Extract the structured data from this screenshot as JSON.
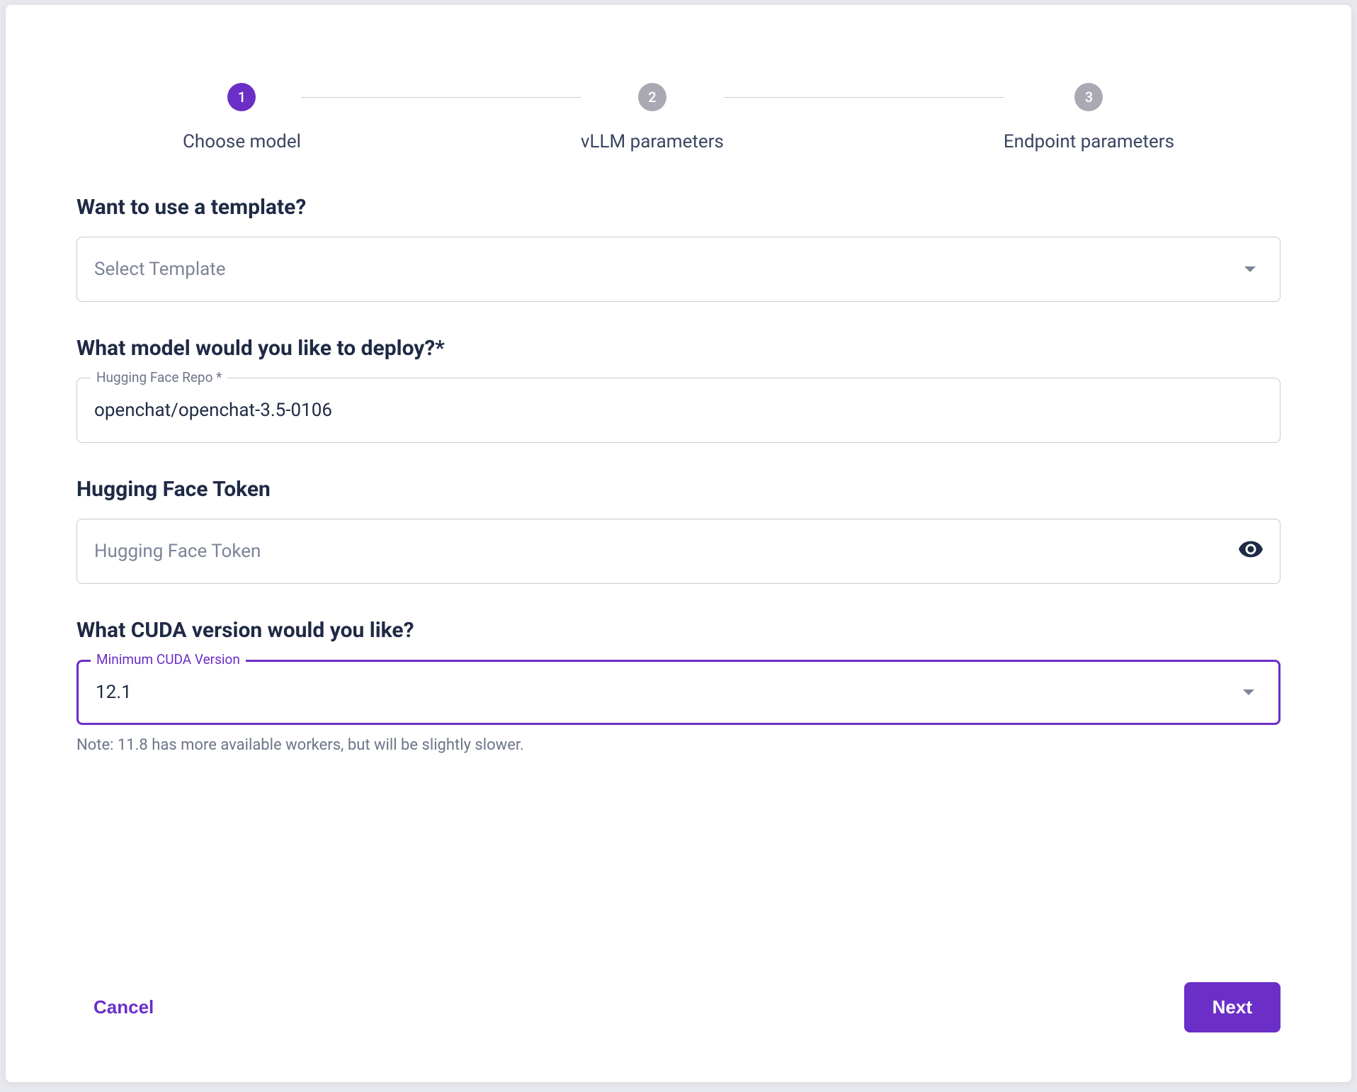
{
  "stepper": {
    "steps": [
      {
        "num": "1",
        "label": "Choose model",
        "active": true
      },
      {
        "num": "2",
        "label": "vLLM parameters",
        "active": false
      },
      {
        "num": "3",
        "label": "Endpoint parameters",
        "active": false
      }
    ]
  },
  "template": {
    "title": "Want to use a template?",
    "placeholder": "Select Template"
  },
  "model": {
    "title": "What model would you like to deploy?*",
    "field_label": "Hugging Face Repo *",
    "value": "openchat/openchat-3.5-0106"
  },
  "token": {
    "title": "Hugging Face Token",
    "placeholder": "Hugging Face Token"
  },
  "cuda": {
    "title": "What CUDA version would you like?",
    "field_label": "Minimum CUDA Version",
    "value": "12.1",
    "note": "Note: 11.8 has more available workers, but will be slightly slower."
  },
  "footer": {
    "cancel": "Cancel",
    "next": "Next"
  }
}
